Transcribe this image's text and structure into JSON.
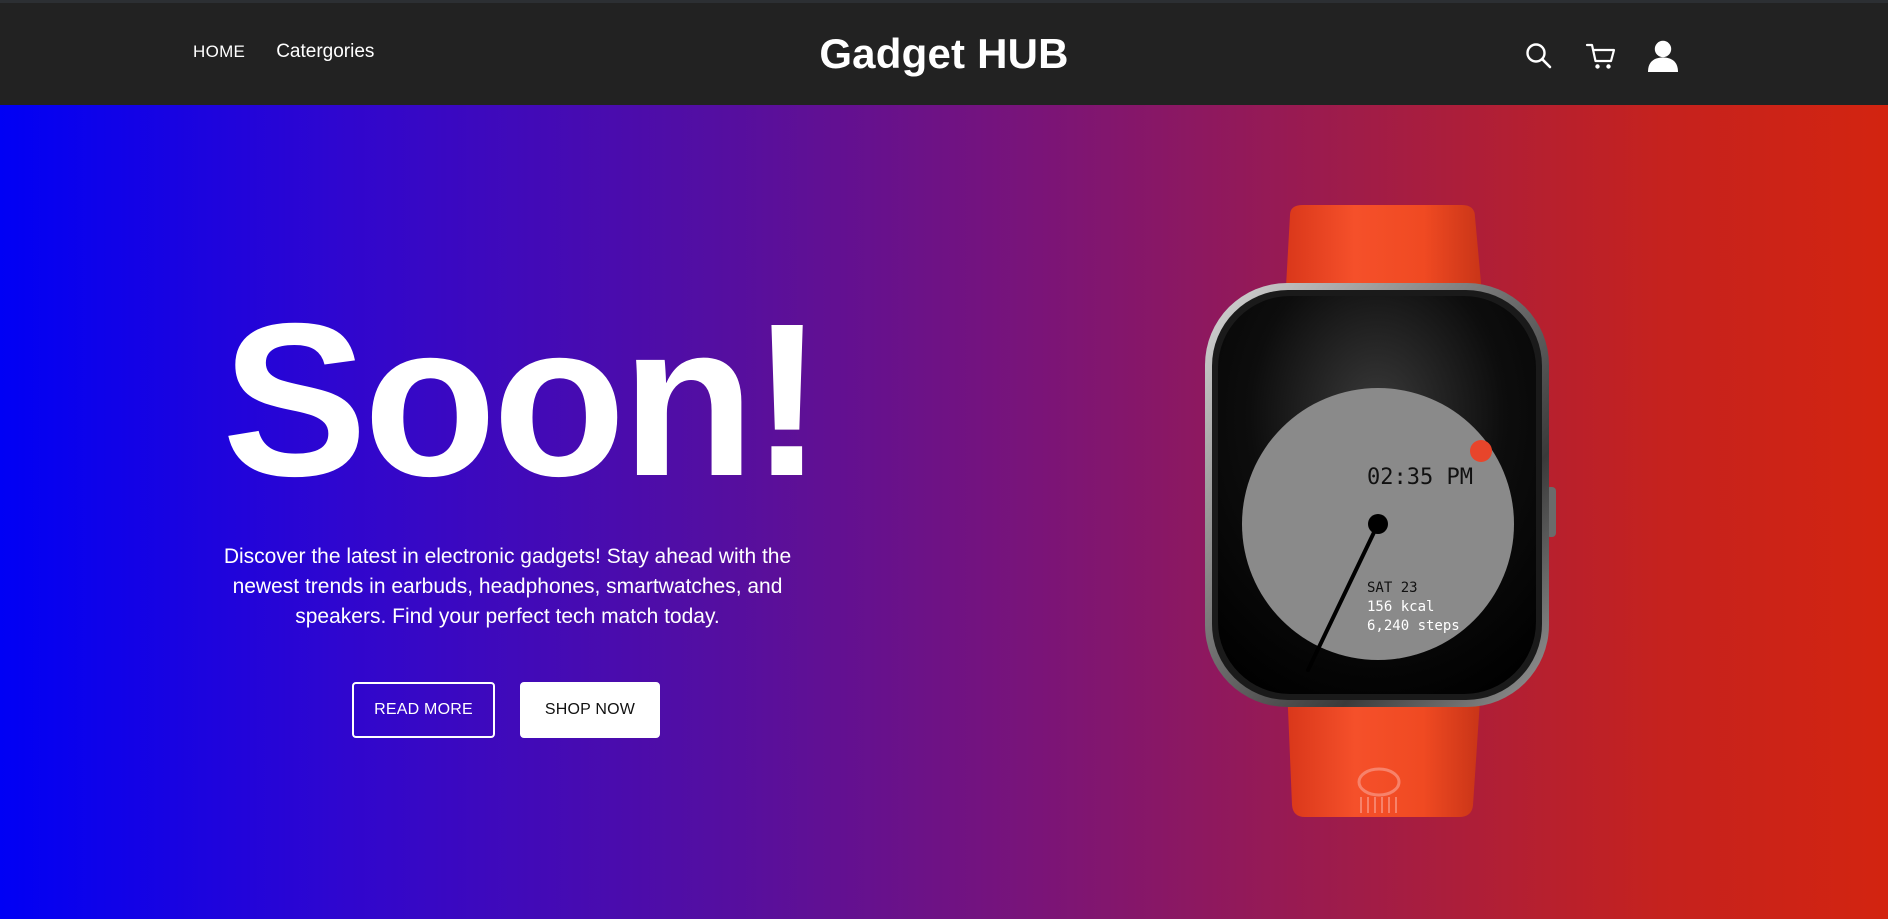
{
  "header": {
    "nav": [
      {
        "label": "HOME"
      },
      {
        "label": "Catergories"
      }
    ],
    "brand": "Gadget HUB",
    "icons": [
      "search-icon",
      "cart-icon",
      "user-icon"
    ]
  },
  "hero": {
    "title": "Soon!",
    "description": "Discover the latest in electronic gadgets! Stay ahead with the newest trends in earbuds, headphones, smartwatches, and speakers. Find your perfect tech match today.",
    "buttons": {
      "read_more": "READ MORE",
      "shop_now": "SHOP NOW"
    },
    "watch_face": {
      "time": "02:35 PM",
      "date": "SAT 23",
      "calories": "156 kcal",
      "steps": "6,240 steps"
    }
  },
  "colors": {
    "header_bg": "#222222",
    "gradient_start": "#0000f5",
    "gradient_end": "#d32410",
    "strap": "#f0451f"
  }
}
